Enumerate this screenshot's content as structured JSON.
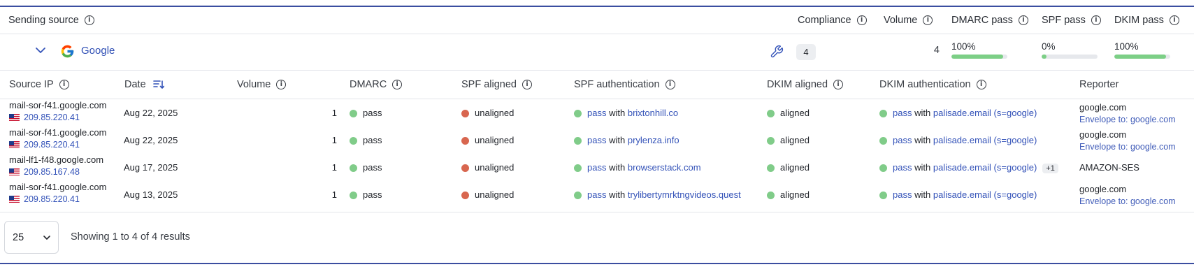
{
  "header": {
    "sending_source": "Sending source",
    "compliance": "Compliance",
    "volume": "Volume",
    "dmarc_pass": "DMARC pass",
    "spf_pass": "SPF pass",
    "dkim_pass": "DKIM pass"
  },
  "group": {
    "name": "Google",
    "issues_count": "4",
    "volume": "4",
    "dmarc_pass": {
      "label": "100%",
      "fraction": 1.0
    },
    "spf_pass": {
      "label": "0%",
      "fraction": 0.0
    },
    "dkim_pass": {
      "label": "100%",
      "fraction": 1.0
    }
  },
  "columns": {
    "source_ip": "Source IP",
    "date": "Date",
    "volume": "Volume",
    "dmarc": "DMARC",
    "spf_aligned": "SPF aligned",
    "spf_auth": "SPF authentication",
    "dkim_aligned": "DKIM aligned",
    "dkim_auth": "DKIM authentication",
    "reporter": "Reporter"
  },
  "words": {
    "pass": "pass",
    "with": "with",
    "aligned": "aligned",
    "unaligned": "unaligned"
  },
  "rows": [
    {
      "host": "mail-sor-f41.google.com",
      "ip": "209.85.220.41",
      "date": "Aug 22, 2025",
      "volume": "1",
      "dmarc": "pass",
      "spf_aligned": "unaligned",
      "spf_domain": "brixtonhill.co",
      "dkim_aligned": "aligned",
      "dkim_domain": "palisade.email (s=google)",
      "dkim_extra": "",
      "reporter": "google.com",
      "reporter_sub": "Envelope to: google.com"
    },
    {
      "host": "mail-sor-f41.google.com",
      "ip": "209.85.220.41",
      "date": "Aug 22, 2025",
      "volume": "1",
      "dmarc": "pass",
      "spf_aligned": "unaligned",
      "spf_domain": "prylenza.info",
      "dkim_aligned": "aligned",
      "dkim_domain": "palisade.email (s=google)",
      "dkim_extra": "",
      "reporter": "google.com",
      "reporter_sub": "Envelope to: google.com"
    },
    {
      "host": "mail-lf1-f48.google.com",
      "ip": "209.85.167.48",
      "date": "Aug 17, 2025",
      "volume": "1",
      "dmarc": "pass",
      "spf_aligned": "unaligned",
      "spf_domain": "browserstack.com",
      "dkim_aligned": "aligned",
      "dkim_domain": "palisade.email (s=google)",
      "dkim_extra": "+1",
      "reporter": "AMAZON-SES",
      "reporter_sub": ""
    },
    {
      "host": "mail-sor-f41.google.com",
      "ip": "209.85.220.41",
      "date": "Aug 13, 2025",
      "volume": "1",
      "dmarc": "pass",
      "spf_aligned": "unaligned",
      "spf_domain": "trylibertymrktngvideos.quest",
      "dkim_aligned": "aligned",
      "dkim_domain": "palisade.email (s=google)",
      "dkim_extra": "",
      "reporter": "google.com",
      "reporter_sub": "Envelope to: google.com"
    }
  ],
  "pagination": {
    "page_size": "25",
    "showing": "Showing 1 to 4 of 4 results"
  },
  "colors": {
    "accent_line": "#3b4ea0",
    "link": "#3352b8",
    "status_green": "#80cc89",
    "status_red": "#d8664f",
    "progress_green": "#7ccf86"
  },
  "icons": [
    "info-icon",
    "chevron-down-icon",
    "google-logo",
    "wrench-icon",
    "sort-descending-icon",
    "us-flag-icon"
  ]
}
